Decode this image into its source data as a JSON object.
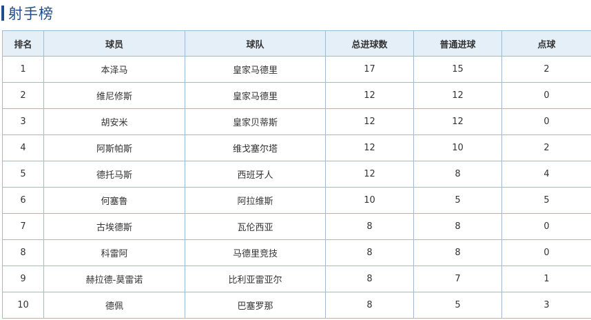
{
  "page_title": "射手榜",
  "accent_color": "#1f4e8c",
  "header_bg_color": "#e5eff8",
  "border_color": "#9dbbd6",
  "columns": {
    "rank": "排名",
    "player": "球员",
    "team": "球队",
    "total_goals": "总进球数",
    "regular_goals": "普通进球",
    "penalties": "点球"
  },
  "rows": [
    {
      "rank": "1",
      "player": "本泽马",
      "team": "皇家马德里",
      "total_goals": "17",
      "regular_goals": "15",
      "penalties": "2"
    },
    {
      "rank": "2",
      "player": "维尼修斯",
      "team": "皇家马德里",
      "total_goals": "12",
      "regular_goals": "12",
      "penalties": "0"
    },
    {
      "rank": "3",
      "player": "胡安米",
      "team": "皇家贝蒂斯",
      "total_goals": "12",
      "regular_goals": "12",
      "penalties": "0"
    },
    {
      "rank": "4",
      "player": "阿斯帕斯",
      "team": "维戈塞尔塔",
      "total_goals": "12",
      "regular_goals": "10",
      "penalties": "2"
    },
    {
      "rank": "5",
      "player": "德托马斯",
      "team": "西班牙人",
      "total_goals": "12",
      "regular_goals": "8",
      "penalties": "4"
    },
    {
      "rank": "6",
      "player": "何塞鲁",
      "team": "阿拉维斯",
      "total_goals": "10",
      "regular_goals": "5",
      "penalties": "5"
    },
    {
      "rank": "7",
      "player": "古埃德斯",
      "team": "瓦伦西亚",
      "total_goals": "8",
      "regular_goals": "8",
      "penalties": "0"
    },
    {
      "rank": "8",
      "player": "科雷阿",
      "team": "马德里竞技",
      "total_goals": "8",
      "regular_goals": "8",
      "penalties": "0"
    },
    {
      "rank": "9",
      "player": "赫拉德-莫雷诺",
      "team": "比利亚雷亚尔",
      "total_goals": "8",
      "regular_goals": "7",
      "penalties": "1"
    },
    {
      "rank": "10",
      "player": "德佩",
      "team": "巴塞罗那",
      "total_goals": "8",
      "regular_goals": "5",
      "penalties": "3"
    }
  ]
}
